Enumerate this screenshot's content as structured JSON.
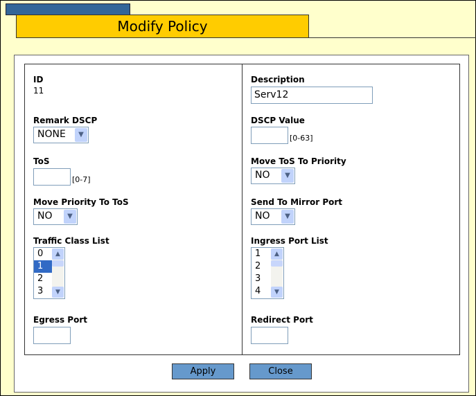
{
  "title": "Modify Policy",
  "left": {
    "id_label": "ID",
    "id_value": "11",
    "remark_dscp_label": "Remark DSCP",
    "remark_dscp_value": "NONE",
    "tos_label": "ToS",
    "tos_value": "",
    "tos_range": "[0-7]",
    "move_priority_label": "Move Priority To ToS",
    "move_priority_value": "NO",
    "traffic_class_label": "Traffic Class List",
    "traffic_class_items": [
      "0",
      "1",
      "2",
      "3"
    ],
    "traffic_class_selected": "1",
    "egress_label": "Egress Port",
    "egress_value": ""
  },
  "right": {
    "description_label": "Description",
    "description_value": "Serv12",
    "dscp_value_label": "DSCP Value",
    "dscp_value": "",
    "dscp_range": "[0-63]",
    "move_tos_label": "Move ToS To Priority",
    "move_tos_value": "NO",
    "mirror_label": "Send To Mirror Port",
    "mirror_value": "NO",
    "ingress_label": "Ingress Port List",
    "ingress_items": [
      "1",
      "2",
      "3",
      "4"
    ],
    "redirect_label": "Redirect Port",
    "redirect_value": ""
  },
  "buttons": {
    "apply": "Apply",
    "close": "Close"
  }
}
